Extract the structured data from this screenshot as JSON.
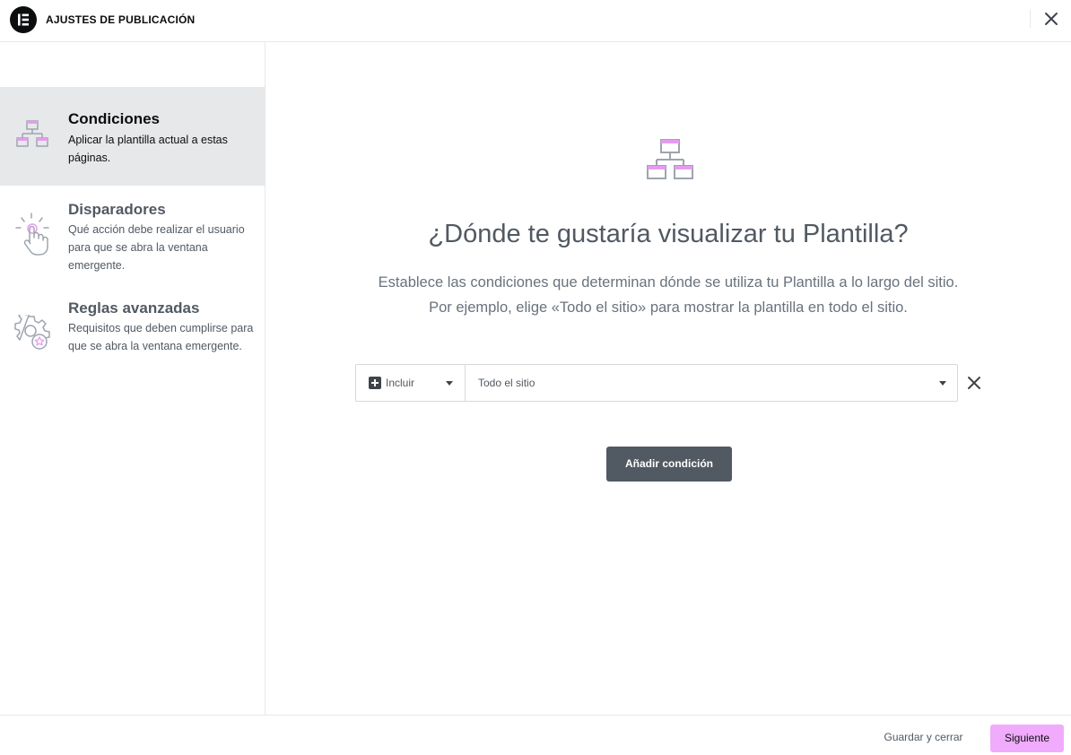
{
  "header": {
    "title": "AJUSTES DE PUBLICACIÓN",
    "logo_icon": "elementor-logo-icon",
    "close_icon": "close-icon"
  },
  "sidebar": {
    "items": [
      {
        "label": "Condiciones",
        "description": "Aplicar la plantilla actual a estas páginas.",
        "icon": "sitemap-icon",
        "active": true
      },
      {
        "label": "Disparadores",
        "description": "Qué acción debe realizar el usuario para que se abra la ventana emergente.",
        "icon": "hand-click-icon",
        "active": false
      },
      {
        "label": "Reglas avanzadas",
        "description": "Requisitos que deben cumplirse para que se abra la ventana emergente.",
        "icon": "gear-star-icon",
        "active": false
      }
    ]
  },
  "main": {
    "icon": "sitemap-icon",
    "heading": "¿Dónde te gustaría visualizar tu Plantilla?",
    "subtext_line1": "Establece las condiciones que determinan dónde se utiliza tu Plantilla a lo largo del sitio.",
    "subtext_line2": "Por ejemplo, elige «Todo el sitio» para mostrar la plantilla en todo el sitio.",
    "condition": {
      "type_value": "Incluir",
      "target_value": "Todo el sitio"
    },
    "add_condition_label": "Añadir condición"
  },
  "footer": {
    "save_close_label": "Guardar y cerrar",
    "next_label": "Siguiente"
  },
  "colors": {
    "accent": "#f0abfc",
    "accent_icon": "#d36ee0",
    "dark_button": "#515962",
    "sidebar_active_bg": "#e6e8ea"
  }
}
